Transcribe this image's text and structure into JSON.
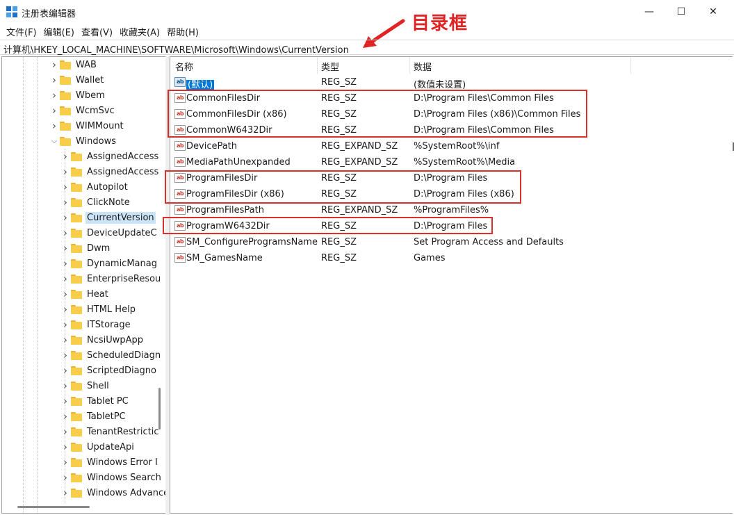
{
  "window": {
    "title": "注册表编辑器",
    "controls": {
      "minimize": "—",
      "maximize": "☐",
      "close": "✕"
    }
  },
  "annotation": {
    "label": "目录框",
    "color": "#e02323"
  },
  "menu": [
    "文件(F)",
    "编辑(E)",
    "查看(V)",
    "收藏夹(A)",
    "帮助(H)"
  ],
  "address": "计算机\\HKEY_LOCAL_MACHINE\\SOFTWARE\\Microsoft\\Windows\\CurrentVersion",
  "tree": [
    {
      "label": "WAB",
      "expanded": false
    },
    {
      "label": "Wallet",
      "expanded": false
    },
    {
      "label": "Wbem",
      "expanded": false
    },
    {
      "label": "WcmSvc",
      "expanded": false
    },
    {
      "label": "WIMMount",
      "expanded": false
    },
    {
      "label": "Windows",
      "expanded": true
    },
    {
      "label": "AssignedAccess",
      "expanded": false
    },
    {
      "label": "AssignedAccess",
      "expanded": false
    },
    {
      "label": "Autopilot",
      "expanded": false
    },
    {
      "label": "ClickNote",
      "expanded": false
    },
    {
      "label": "CurrentVersion",
      "expanded": false,
      "selected": true
    },
    {
      "label": "DeviceUpdateC",
      "expanded": false
    },
    {
      "label": "Dwm",
      "expanded": false
    },
    {
      "label": "DynamicManag",
      "expanded": false
    },
    {
      "label": "EnterpriseResou",
      "expanded": false
    },
    {
      "label": "Heat",
      "expanded": false
    },
    {
      "label": "HTML Help",
      "expanded": false
    },
    {
      "label": "ITStorage",
      "expanded": false
    },
    {
      "label": "NcsiUwpApp",
      "expanded": false
    },
    {
      "label": "ScheduledDiagn",
      "expanded": false
    },
    {
      "label": "ScriptedDiagno",
      "expanded": false
    },
    {
      "label": "Shell",
      "expanded": false
    },
    {
      "label": "Tablet PC",
      "expanded": false
    },
    {
      "label": "TabletPC",
      "expanded": false
    },
    {
      "label": "TenantRestrictic",
      "expanded": false
    },
    {
      "label": "UpdateApi",
      "expanded": false
    },
    {
      "label": "Windows Error I",
      "expanded": false
    },
    {
      "label": "Windows Search",
      "expanded": false
    },
    {
      "label": "Windows Advance",
      "expanded": false
    }
  ],
  "columns": {
    "name": "名称",
    "type": "类型",
    "data": "数据"
  },
  "icon_text": "ab",
  "values": [
    {
      "name": "(默认)",
      "type": "REG_SZ",
      "data": "(数值未设置)",
      "selected": true
    },
    {
      "name": "CommonFilesDir",
      "type": "REG_SZ",
      "data": "D:\\Program Files\\Common Files"
    },
    {
      "name": "CommonFilesDir (x86)",
      "type": "REG_SZ",
      "data": "D:\\Program Files (x86)\\Common Files"
    },
    {
      "name": "CommonW6432Dir",
      "type": "REG_SZ",
      "data": "D:\\Program Files\\Common Files"
    },
    {
      "name": "DevicePath",
      "type": "REG_EXPAND_SZ",
      "data": "%SystemRoot%\\inf"
    },
    {
      "name": "MediaPathUnexpanded",
      "type": "REG_EXPAND_SZ",
      "data": "%SystemRoot%\\Media"
    },
    {
      "name": "ProgramFilesDir",
      "type": "REG_SZ",
      "data": "D:\\Program Files"
    },
    {
      "name": "ProgramFilesDir (x86)",
      "type": "REG_SZ",
      "data": "D:\\Program Files (x86)"
    },
    {
      "name": "ProgramFilesPath",
      "type": "REG_EXPAND_SZ",
      "data": "%ProgramFiles%"
    },
    {
      "name": "ProgramW6432Dir",
      "type": "REG_SZ",
      "data": "D:\\Program Files"
    },
    {
      "name": "SM_ConfigureProgramsName",
      "type": "REG_SZ",
      "data": "Set Program Access and Defaults"
    },
    {
      "name": "SM_GamesName",
      "type": "REG_SZ",
      "data": "Games"
    }
  ],
  "highlight_color": "#d9302c"
}
